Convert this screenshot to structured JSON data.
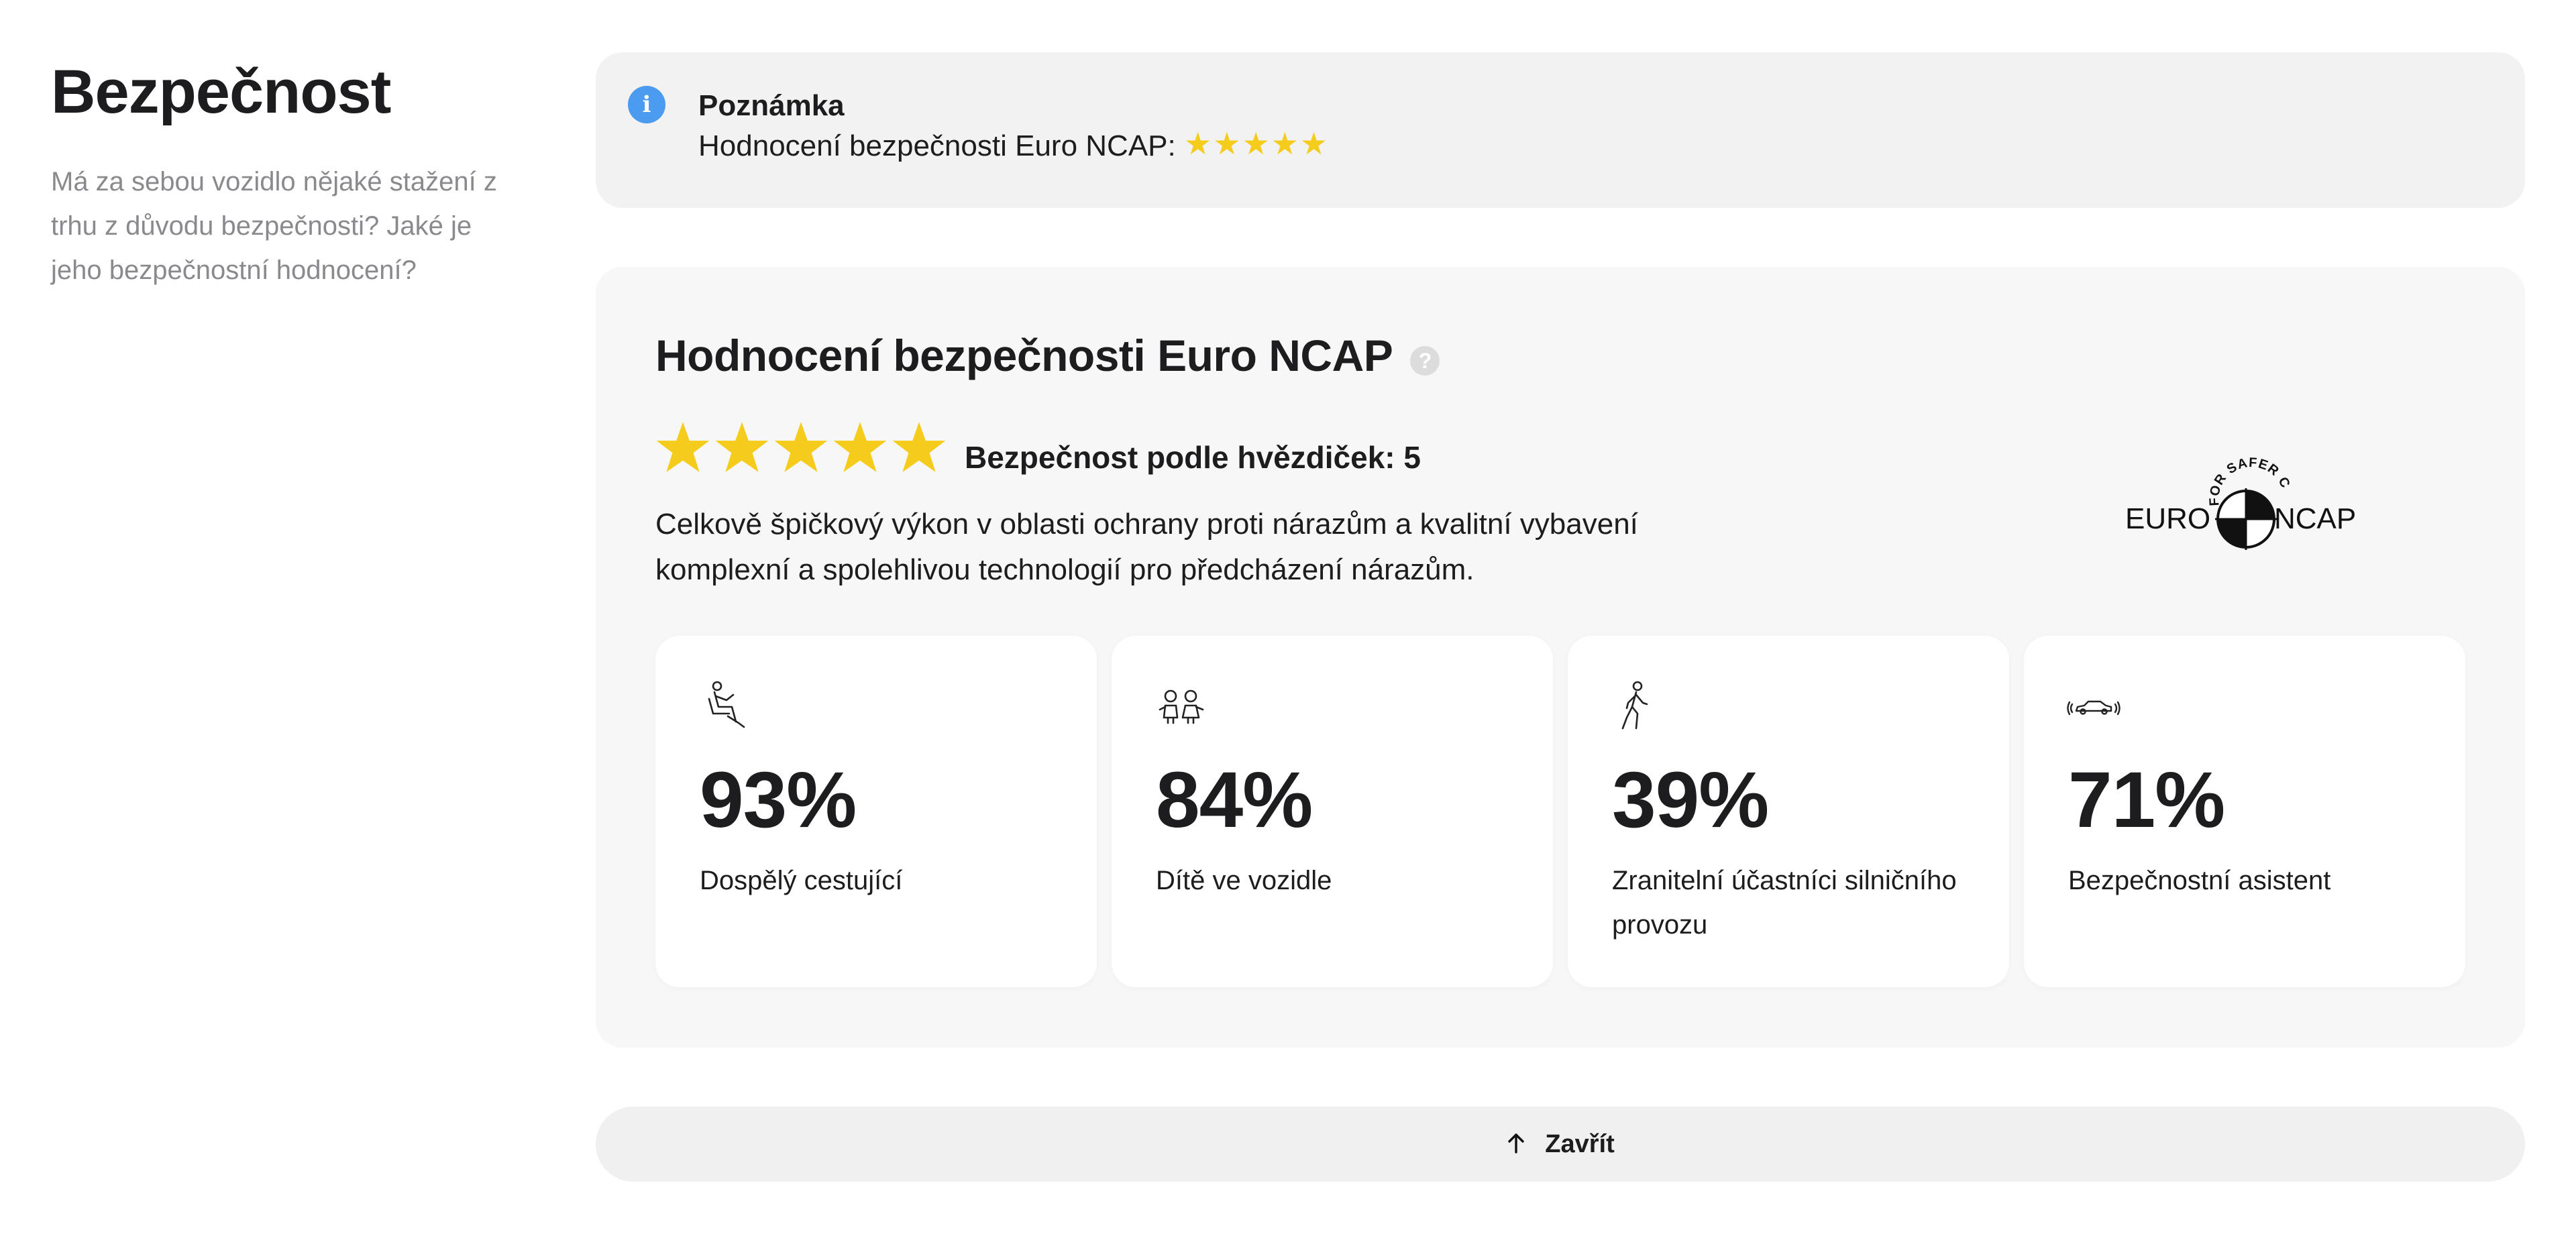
{
  "section": {
    "title": "Bezpečnost",
    "description": "Má za sebou vozidlo nějaké stažení z trhu z důvodu bezpečnosti? Jaké je jeho bezpečnostní hodnocení?"
  },
  "note": {
    "icon": "info-icon",
    "title": "Poznámka",
    "text": "Hodnocení bezpečnosti Euro NCAP:",
    "stars": "★★★★★",
    "star_count": 5
  },
  "ncap": {
    "title": "Hodnocení bezpečnosti Euro NCAP",
    "help_icon": "?",
    "star_label": "Bezpečnost podle hvězdiček: 5",
    "star_rating": 5,
    "star_color": "#f5cc1b",
    "description": "Celkově špičkový výkon v oblasti ochrany proti nárazům a kvalitní vybavení komplexní a spolehlivou technologií pro předcházení nárazům.",
    "logo": {
      "arc_text": "FOR SAFER CARS",
      "left_text": "EURO",
      "right_text": "NCAP"
    },
    "cards": [
      {
        "icon": "seated-adult-icon",
        "value": "93%",
        "label": "Dospělý cestující"
      },
      {
        "icon": "children-icon",
        "value": "84%",
        "label": "Dítě ve vozidle"
      },
      {
        "icon": "pedestrian-icon",
        "value": "39%",
        "label": "Zranitelní účastníci silničního provozu"
      },
      {
        "icon": "car-sensor-icon",
        "value": "71%",
        "label": "Bezpečnostní asistent"
      }
    ]
  },
  "close_button": {
    "label": "Zavřít",
    "icon": "arrow-up-icon"
  },
  "colors": {
    "accent_blue": "#4b9cf0",
    "star_yellow": "#f5cc1b",
    "panel_bg": "#f7f7f7",
    "note_bg": "#f2f2f2"
  }
}
